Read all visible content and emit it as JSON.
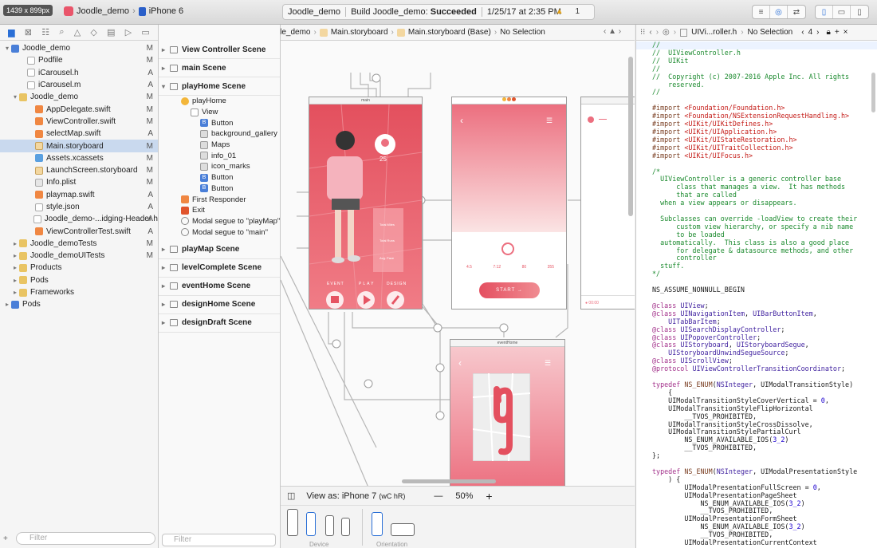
{
  "toolbar": {
    "screen_size": "1439 x 899px",
    "scheme": "Joodle_demo",
    "device": "iPhone 6",
    "status_project": "Joodle_demo",
    "status_build_prefix": "Build Joodle_demo:",
    "status_build_result": "Succeeded",
    "status_time": "1/25/17 at 2:35 PM",
    "warning_count": "1"
  },
  "navigator": {
    "filter_placeholder": "Filter",
    "items": [
      {
        "label": "Joodle_demo",
        "flag": "M",
        "icon": "project-icon",
        "indent": 0,
        "tri": "▾"
      },
      {
        "label": "Podfile",
        "flag": "M",
        "icon": "file-icon",
        "indent": 2,
        "tri": ""
      },
      {
        "label": "iCarousel.h",
        "flag": "A",
        "icon": "header-file-icon",
        "indent": 2,
        "tri": ""
      },
      {
        "label": "iCarousel.m",
        "flag": "A",
        "icon": "objc-file-icon",
        "indent": 2,
        "tri": ""
      },
      {
        "label": "Joodle_demo",
        "flag": "M",
        "icon": "folder-icon",
        "indent": 1,
        "tri": "▾"
      },
      {
        "label": "AppDelegate.swift",
        "flag": "M",
        "icon": "swift-file-icon",
        "indent": 3,
        "tri": ""
      },
      {
        "label": "ViewController.swift",
        "flag": "M",
        "icon": "swift-file-icon",
        "indent": 3,
        "tri": ""
      },
      {
        "label": "selectMap.swift",
        "flag": "A",
        "icon": "swift-file-icon",
        "indent": 3,
        "tri": ""
      },
      {
        "label": "Main.storyboard",
        "flag": "M",
        "icon": "storyboard-file-icon",
        "indent": 3,
        "tri": "",
        "selected": true
      },
      {
        "label": "Assets.xcassets",
        "flag": "M",
        "icon": "assets-icon",
        "indent": 3,
        "tri": ""
      },
      {
        "label": "LaunchScreen.storyboard",
        "flag": "M",
        "icon": "storyboard-file-icon",
        "indent": 3,
        "tri": ""
      },
      {
        "label": "Info.plist",
        "flag": "M",
        "icon": "plist-file-icon",
        "indent": 3,
        "tri": ""
      },
      {
        "label": "playmap.swift",
        "flag": "A",
        "icon": "swift-file-icon",
        "indent": 3,
        "tri": ""
      },
      {
        "label": "style.json",
        "flag": "A",
        "icon": "json-file-icon",
        "indent": 3,
        "tri": ""
      },
      {
        "label": "Joodle_demo-...idging-Header.h",
        "flag": "A",
        "icon": "header-file-icon",
        "indent": 3,
        "tri": ""
      },
      {
        "label": "ViewControllerTest.swift",
        "flag": "A",
        "icon": "swift-file-icon",
        "indent": 3,
        "tri": ""
      },
      {
        "label": "Joodle_demoTests",
        "flag": "M",
        "icon": "folder-icon",
        "indent": 1,
        "tri": "▸"
      },
      {
        "label": "Joodle_demoUITests",
        "flag": "M",
        "icon": "folder-icon",
        "indent": 1,
        "tri": "▸"
      },
      {
        "label": "Products",
        "flag": "",
        "icon": "folder-icon",
        "indent": 1,
        "tri": "▸"
      },
      {
        "label": "Pods",
        "flag": "",
        "icon": "folder-icon",
        "indent": 1,
        "tri": "▸"
      },
      {
        "label": "Frameworks",
        "flag": "",
        "icon": "folder-icon",
        "indent": 1,
        "tri": "▸"
      },
      {
        "label": "Pods",
        "flag": "",
        "icon": "project-icon",
        "indent": 0,
        "tri": "▸"
      }
    ]
  },
  "jumpbar": {
    "crumbs": [
      "Joodle_demo",
      "Joodle_demo",
      "Main.storyboard",
      "Main.storyboard (Base)",
      "No Selection"
    ]
  },
  "outline": {
    "filter_placeholder": "Filter",
    "scenes_top": [
      "View Controller Scene",
      "main Scene"
    ],
    "open_scene": "playHome Scene",
    "open_rows": [
      {
        "label": "playHome",
        "kind": "vc",
        "indent": 1
      },
      {
        "label": "View",
        "kind": "view",
        "indent": 2
      },
      {
        "label": "Button",
        "kind": "btn",
        "indent": 3
      },
      {
        "label": "background_gallery",
        "kind": "img",
        "indent": 3
      },
      {
        "label": "Maps",
        "kind": "img",
        "indent": 3
      },
      {
        "label": "info_01",
        "kind": "img",
        "indent": 3
      },
      {
        "label": "icon_marks",
        "kind": "img",
        "indent": 3
      },
      {
        "label": "Button",
        "kind": "btn",
        "indent": 3
      },
      {
        "label": "Button",
        "kind": "btn",
        "indent": 3
      },
      {
        "label": "First Responder",
        "kind": "fr",
        "indent": 1
      },
      {
        "label": "Exit",
        "kind": "exit",
        "indent": 1
      },
      {
        "label": "Modal segue to \"playMap\"",
        "kind": "seg",
        "indent": 1
      },
      {
        "label": "Modal segue to \"main\"",
        "kind": "seg",
        "indent": 1
      }
    ],
    "scenes_bottom": [
      "playMap Scene",
      "levelComplete Scene",
      "eventHome Scene",
      "designHome Scene",
      "designDraft Scene"
    ]
  },
  "canvas": {
    "screen1_title": "main",
    "screen1_number": "25",
    "screen1_stats": [
      "Total Miles",
      "Total Runs",
      "Avg. Pace"
    ],
    "screen1_tabs": [
      "EVENT",
      "PLAY",
      "DESIGN"
    ],
    "screen2_start": "START",
    "screen2_stats": [
      "4.5",
      "7:12",
      "80",
      "355"
    ],
    "screen3_time": "00:00",
    "screen4_title": "eventHome",
    "view_as": "View as: iPhone 7",
    "size_class": "(wC hR)",
    "zoom": "50%",
    "minus": "—",
    "plus": "+",
    "device_label": "Device",
    "orientation_label": "Orientation"
  },
  "editor": {
    "file": "UIVi...roller.h",
    "selection": "No Selection",
    "counter": "4"
  },
  "colors": {
    "accent": "#2a6fd6",
    "pink": "#ec6f7f",
    "selection": "#c9d9ee"
  }
}
